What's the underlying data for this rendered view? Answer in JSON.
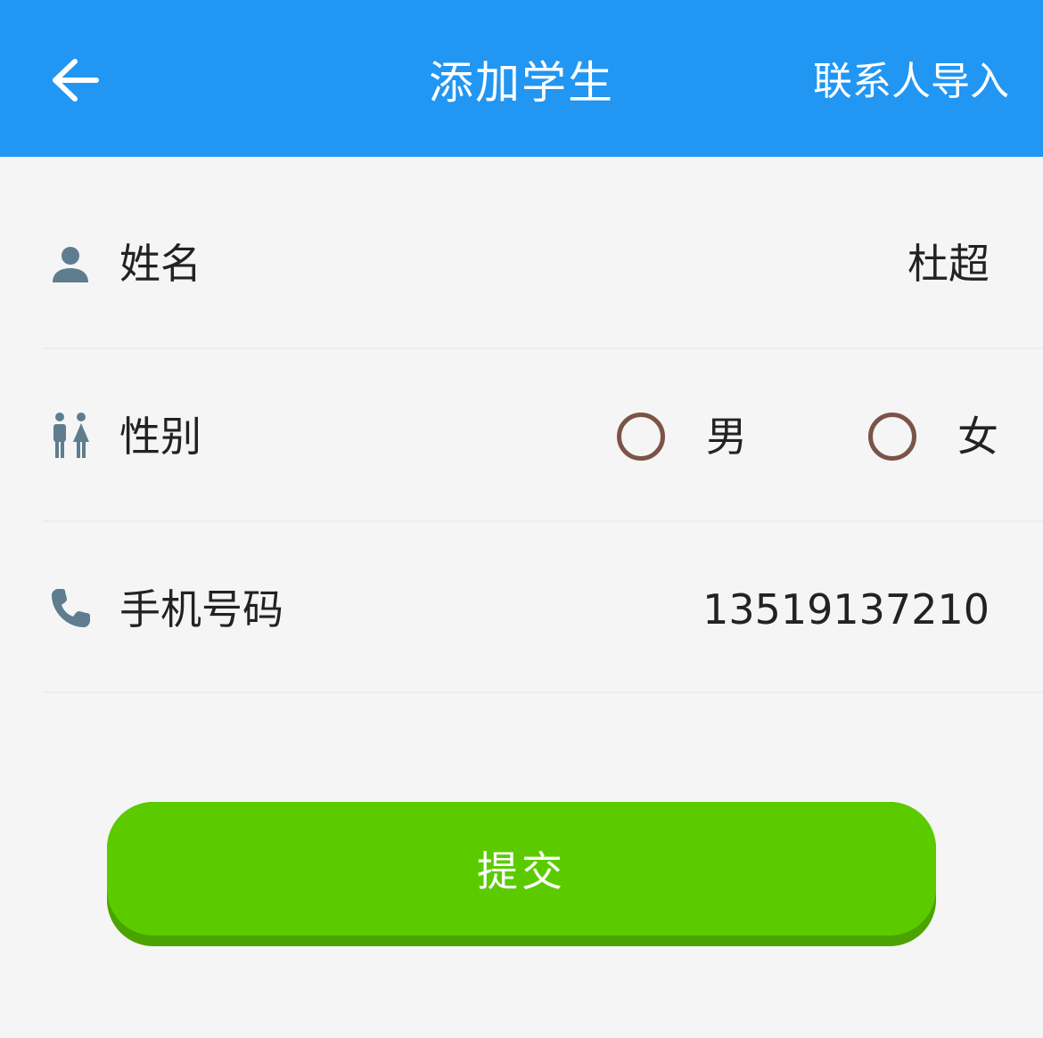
{
  "header": {
    "title": "添加学生",
    "import_label": "联系人导入",
    "back_icon": "arrow-left-icon"
  },
  "form": {
    "name": {
      "label": "姓名",
      "value": "杜超",
      "icon": "person-icon"
    },
    "gender": {
      "label": "性别",
      "icon": "people-icon",
      "options": [
        {
          "label": "男",
          "selected": false
        },
        {
          "label": "女",
          "selected": false
        }
      ]
    },
    "phone": {
      "label": "手机号码",
      "value": "13519137210",
      "icon": "phone-icon"
    }
  },
  "submit": {
    "label": "提交"
  },
  "colors": {
    "header": "#2196f3",
    "submit": "#5bcb00",
    "submit_shadow": "#4aa300",
    "icon": "#5f7d8e",
    "radio_border": "#7b5447"
  }
}
